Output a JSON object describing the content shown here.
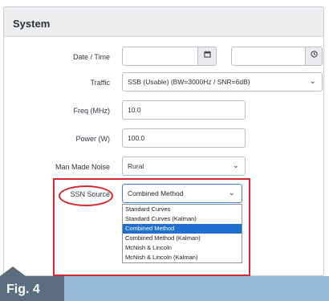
{
  "panel": {
    "title": "System"
  },
  "form": {
    "date_time": {
      "label": "Date / Time",
      "date_value": "",
      "time_value": "",
      "calendar_icon": "calendar-icon",
      "clock_icon": "clock-icon"
    },
    "traffic": {
      "label": "Traffic",
      "value": "SSB (Usable) (BW=3000Hz / SNR=6dB)"
    },
    "freq": {
      "label": "Freq (MHz)",
      "value": "10.0"
    },
    "power": {
      "label": "Power (W)",
      "value": "100.0"
    },
    "noise": {
      "label": "Man Made Noise",
      "value": "Rural"
    },
    "ssn": {
      "label": "SSN Source",
      "value": "Combined Method",
      "options": [
        "Standard Curves",
        "Standard Curves (Kalman)",
        "Combined Method",
        "Combined Method (Kalman)",
        "McNish & Lincoln",
        "McNish & Lincoln (Kalman)"
      ],
      "selected_index": 2
    }
  },
  "figure": {
    "label": "Fig. 4"
  },
  "colors": {
    "highlight": "#d6282f",
    "selection": "#1f6fd0",
    "caption_bar": "#94b9d4",
    "caption_tab": "#5a6e7f"
  }
}
